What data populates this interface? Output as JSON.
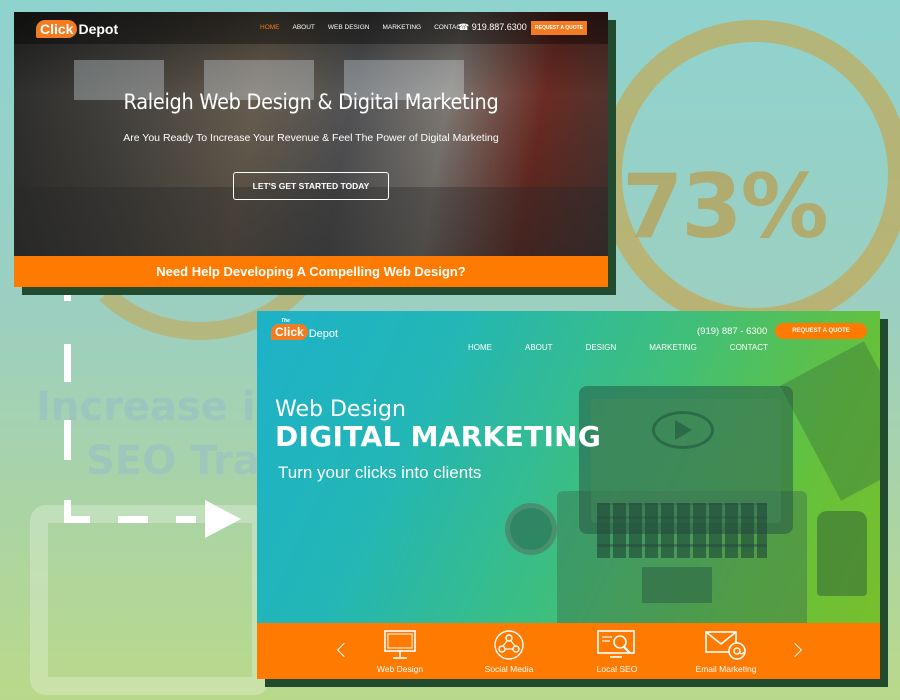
{
  "background": {
    "stat": "73%",
    "text_line1": "Increase in Le",
    "text_line2": "SEO Traffi"
  },
  "old_site": {
    "logo": {
      "click": "Click",
      "depot": "Depot"
    },
    "nav": [
      "HOME",
      "ABOUT",
      "WEB DESIGN",
      "MARKETING",
      "CONTACT"
    ],
    "phone": "☎ 919.887.6300",
    "quote_button": "REQUEST A QUOTE",
    "headline": "Raleigh Web Design & Digital Marketing",
    "subheadline": "Are You Ready To Increase Your Revenue & Feel The Power of Digital Marketing",
    "cta": "LET'S GET STARTED TODAY",
    "bottom_bar": "Need Help Developing A Compelling Web Design?"
  },
  "new_site": {
    "logo": {
      "the": "The",
      "click": "Click",
      "depot": "Depot"
    },
    "phone": "(919) 887 - 6300",
    "quote_button": "REQUEST A QUOTE",
    "nav": [
      "HOME",
      "ABOUT",
      "DESIGN",
      "MARKETING",
      "CONTACT"
    ],
    "headline_small": "Web Design",
    "headline_big": "DIGITAL MARKETING",
    "tagline": "Turn your clicks into clients",
    "services": [
      {
        "label": "Web Design",
        "icon": "monitor-icon"
      },
      {
        "label": "Social Media",
        "icon": "social-network-icon"
      },
      {
        "label": "Local SEO",
        "icon": "search-screen-icon"
      },
      {
        "label": "Email Marketing",
        "icon": "email-at-icon"
      }
    ]
  },
  "colors": {
    "accent": "#ff7a00",
    "shadow": "#214a2e",
    "teal": "#1eb2c8",
    "green": "#7cbe2a"
  }
}
